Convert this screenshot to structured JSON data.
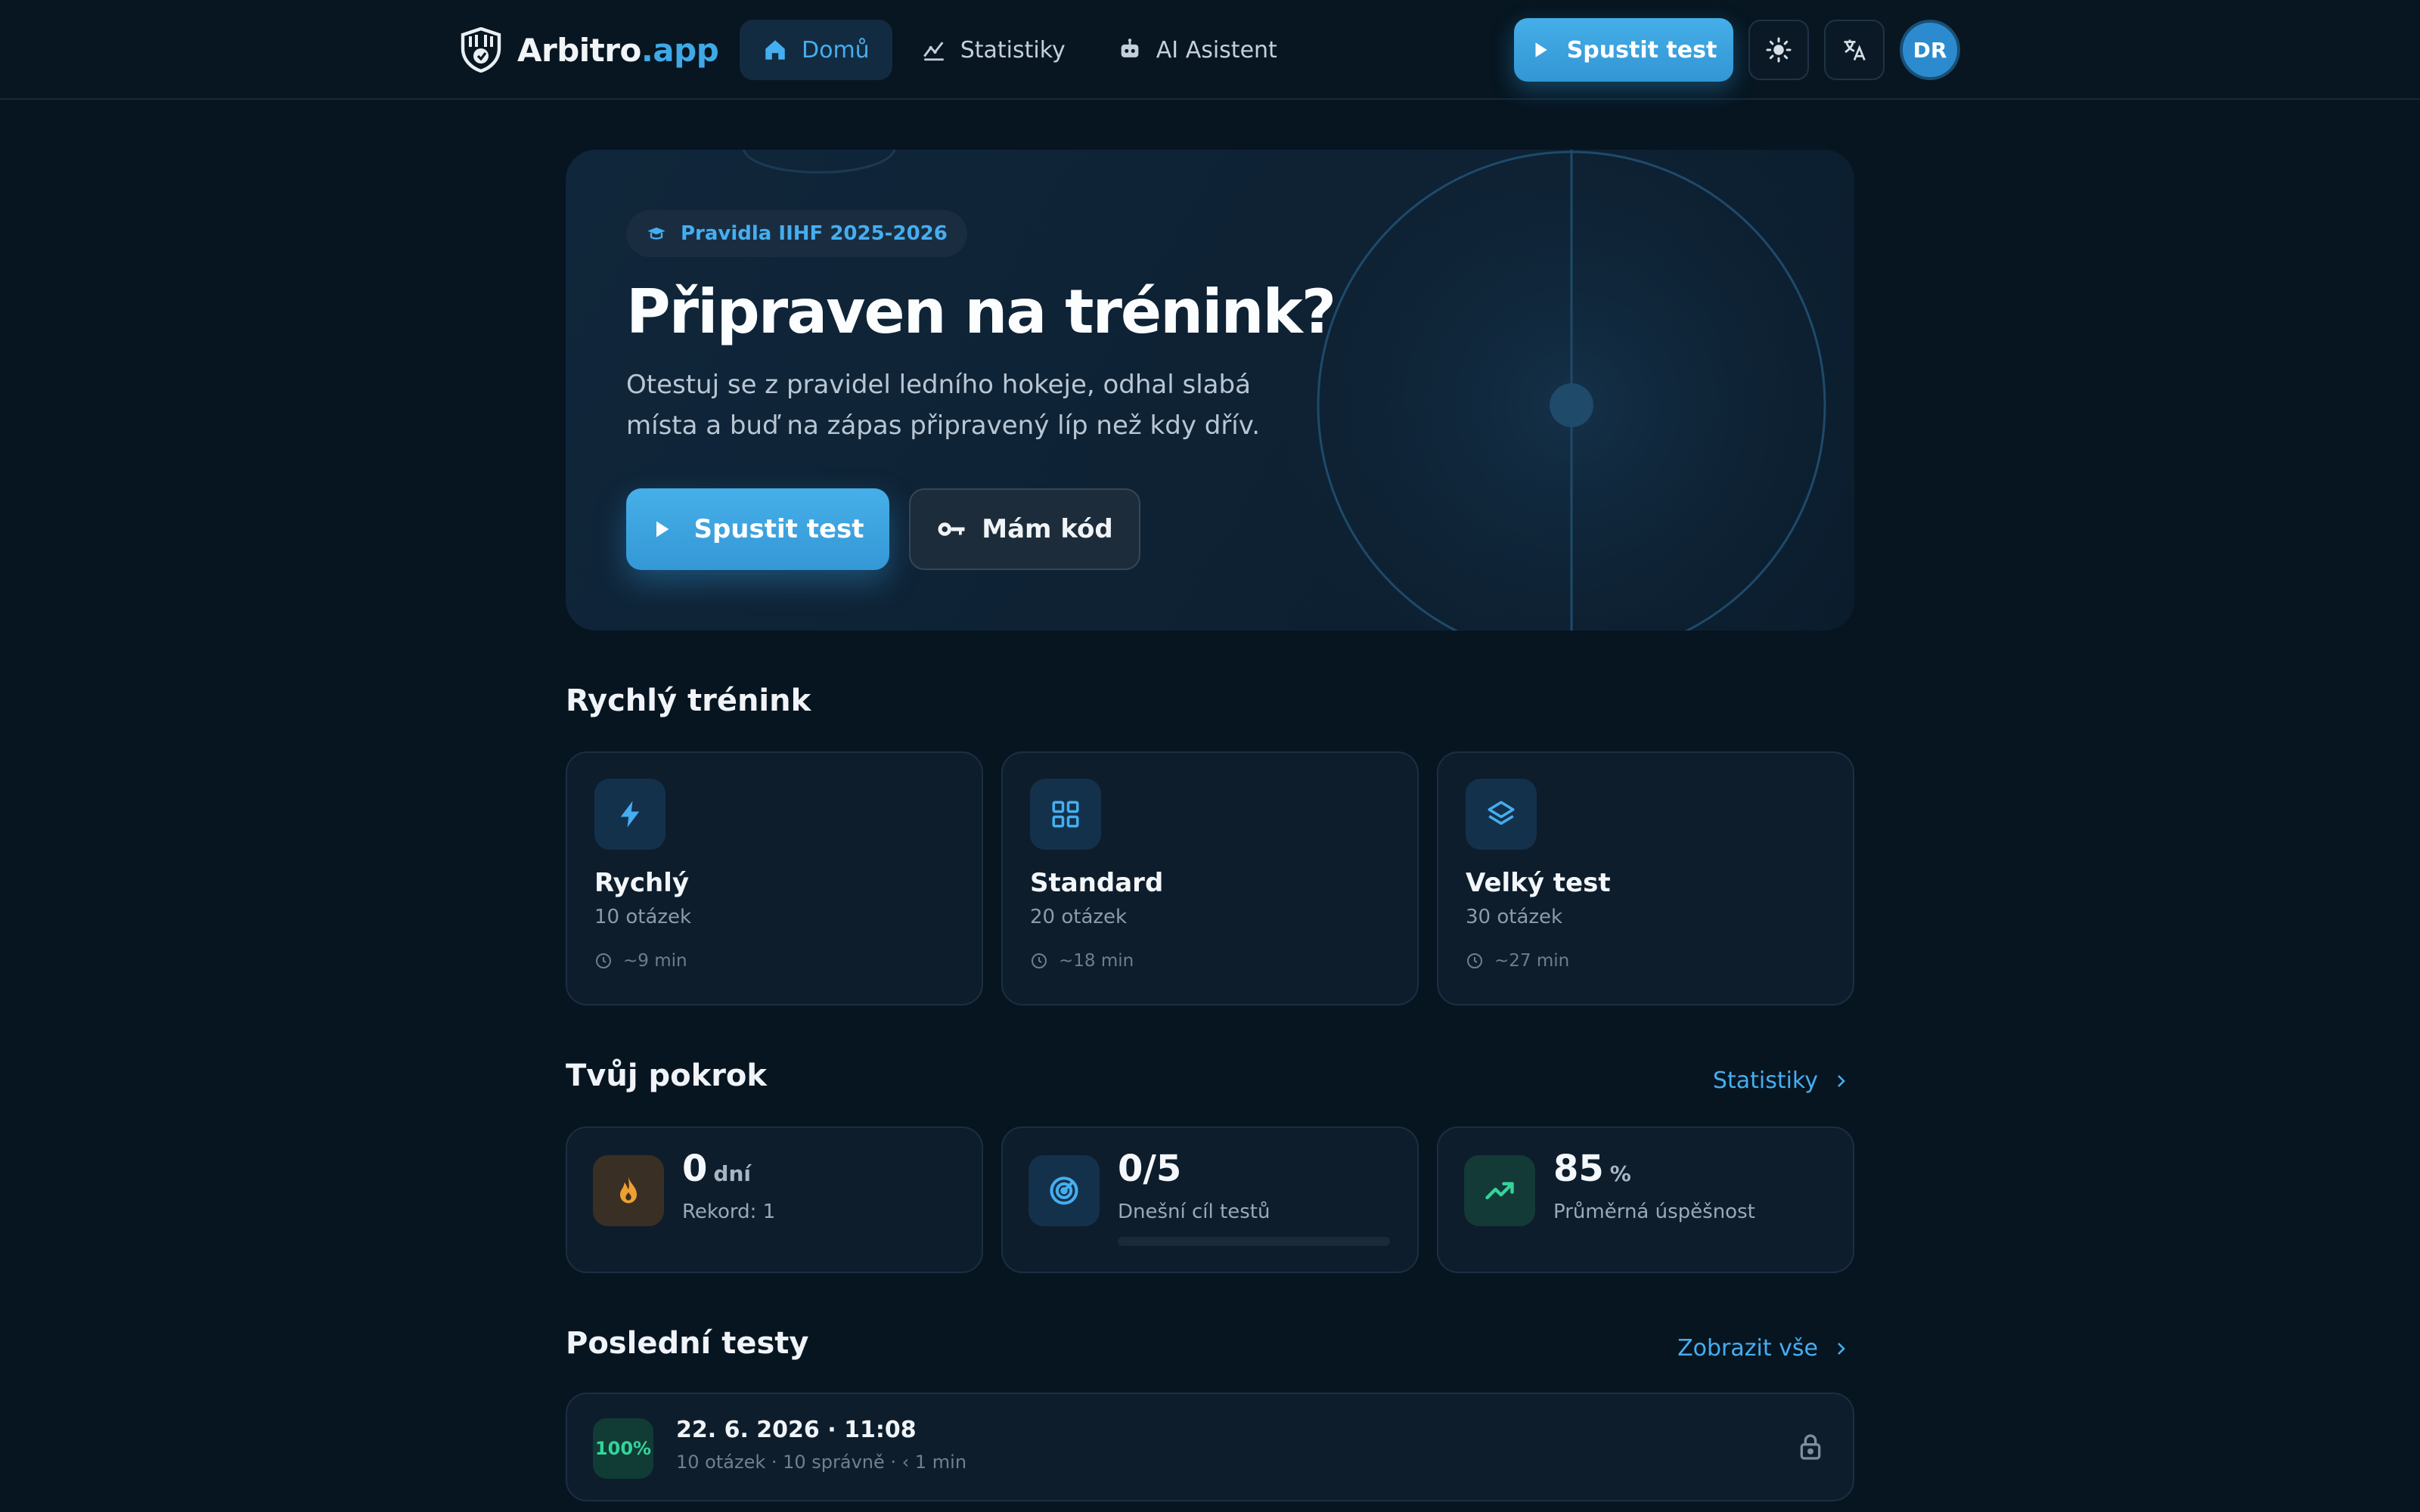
{
  "header": {
    "brand_main": "Arbitro",
    "brand_accent": ".app",
    "nav": [
      {
        "label": "Domů",
        "icon": "home-icon",
        "active": true
      },
      {
        "label": "Statistiky",
        "icon": "chart-icon",
        "active": false
      },
      {
        "label": "AI Asistent",
        "icon": "robot-icon",
        "active": false
      }
    ],
    "cta_label": "Spustit test",
    "avatar_initials": "DR"
  },
  "hero": {
    "badge": "Pravidla IIHF 2025-2026",
    "title": "Připraven na trénink?",
    "subtitle": "Otestuj se z pravidel ledního hokeje, odhal slabá místa a buď na zápas připravený líp než kdy dřív.",
    "primary_label": "Spustit test",
    "secondary_label": "Mám kód"
  },
  "quick": {
    "title": "Rychlý trénink",
    "tiles": [
      {
        "title": "Rychlý",
        "questions": "10 otázek",
        "time": "~9 min",
        "icon": "bolt-icon"
      },
      {
        "title": "Standard",
        "questions": "20 otázek",
        "time": "~18 min",
        "icon": "grid-icon"
      },
      {
        "title": "Velký test",
        "questions": "30 otázek",
        "time": "~27 min",
        "icon": "layers-icon"
      }
    ]
  },
  "progress": {
    "title": "Tvůj pokrok",
    "link": "Statistiky",
    "streak": {
      "value": "0",
      "unit": "dní",
      "label": "Rekord: 1"
    },
    "goal": {
      "value": "0/5",
      "label": "Dnešní cíl testů",
      "fraction": 0
    },
    "success": {
      "value": "85",
      "unit": "%",
      "label": "Průměrná úspěšnost"
    }
  },
  "recent": {
    "title": "Poslední testy",
    "link": "Zobrazit vše",
    "items": [
      {
        "score": "100%",
        "date": "22. 6. 2026 · 11:08",
        "meta": "10 otázek · 10 správně · ‹ 1 min"
      }
    ]
  },
  "colors": {
    "accent": "#3fa9e6",
    "background": "#071521",
    "success": "#34d49a",
    "streak": "#f0a030"
  }
}
